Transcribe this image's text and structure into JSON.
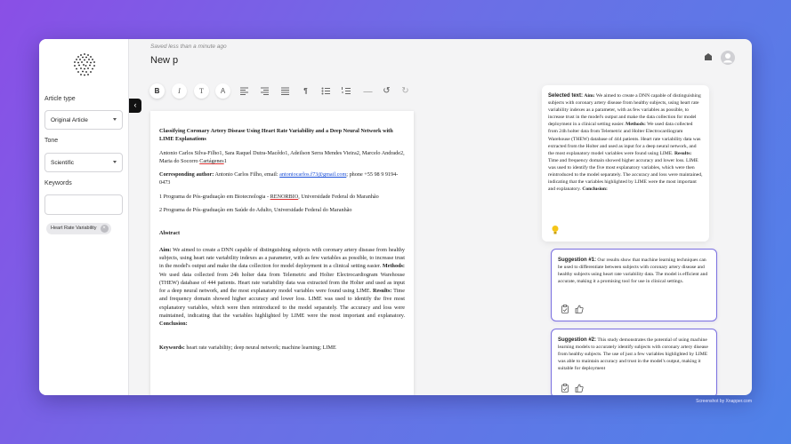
{
  "sidebar": {
    "article_type_label": "Article type",
    "article_type_value": "Original Article",
    "tone_label": "Tone",
    "tone_value": "Scientific",
    "keywords_label": "Keywords",
    "keyword_chip": "Heart Rate Variability",
    "chip_remove": "×"
  },
  "header": {
    "saved_status": "Saved less than a minute ago",
    "doc_title": "New p",
    "collapse_icon": "‹"
  },
  "toolbar": {
    "bold": "B",
    "italic": "I",
    "text": "T",
    "font": "A",
    "paragraph": "¶",
    "underscore": "___",
    "undo": "↺",
    "redo": "↻"
  },
  "document": {
    "title": "Classifying Coronary Artery Disease Using Heart Rate Variability and a Deep Neural Network with LIME Explanations",
    "authors_a": "Antonio Carlos Silva-Filho1, Sara Raquel Dutra-Macêdo1, Adeilson Serra Mendes Vieira2, Marcelo Andrade2, Maria do Socorro ",
    "authors_b": "Cartágenes",
    "authors_c": "1",
    "corr_label": "Corresponding author:",
    "corr_text_a": " Antonio Carlos Filho, email: ",
    "corr_email": "antoniocarlos.f73@gmail.com",
    "corr_text_b": "; phone +55 98 9 9194-0473",
    "aff1_a": "1 Programa de Pós-graduação em Biotecnologia - ",
    "aff1_b": "RENORBIO",
    "aff1_c": ", Universidade Federal do Maranhão",
    "aff2": "2 Programa de Pós-graduação em Saúde do Adulto, Universidade Federal do Maranhão",
    "abstract_heading": "Abstract",
    "aim_label": "Aim:",
    "aim_text": " We aimed to create a DNN capable of distinguishing subjects with coronary artery disease from healthy subjects, using heart rate variability indexes as a parameter, with as few variables as possible, to increase trust in the model's output and make the data collection for model deployment in a clinical setting easier. ",
    "methods_label": "Methods:",
    "methods_text": " We used data collected from 24h holter data from Telemetric and Holter Electrocardiogram Warehouse (THEW) database of 444 patients. Heart rate variability data was extracted from the Holter and used as input for a deep neural network, and the most explanatory model variables were found using LIME. ",
    "results_label": "Results:",
    "results_text": " Time and frequency domain showed higher accuracy and lower loss. LIME was used to identify the five most explanatory variables, which were then reintroduced to the model separately. The accuracy and loss were maintained, indicating that the variables highlighted by LIME were the most important and explanatory. ",
    "conclusion_label": "Conclusion:",
    "keywords_label": "Keywords:",
    "keywords_text": " heart rate variability; deep neural network; machine learning; LIME"
  },
  "assistant": {
    "selected_label": "Selected text:",
    "selected_aim_label": "Aim:",
    "selected_aim": " We aimed to create a DNN capable of distinguishing subjects with coronary artery disease from healthy subjects, using heart rate variability indexes as a parameter, with as few variables as possible, to increase trust in the model's output and make the data collection for model deployment in a clinical setting easier. ",
    "selected_methods_label": "Methods:",
    "selected_methods": " We used data collected from 24h holter data from Telemetric and Holter Electrocardiogram Warehouse (THEW) database of 444 patients. Heart rate variability data was extracted from the Holter and used as input for a deep neural network, and the most explanatory model variables were found using LIME. ",
    "selected_results_label": "Results:",
    "selected_results": " Time and frequency domain showed higher accuracy and lower loss. LIME was used to identify the five most explanatory variables, which were then reintroduced to the model separately. The accuracy and loss were maintained, indicating that the variables highlighted by LIME were the most important and explanatory. ",
    "selected_conclusion_label": "Conclusion:",
    "suggestions": [
      {
        "label": "Suggestion #1:",
        "text": " Our results show that machine learning techniques can be used to differentiate between subjects with coronary artery disease and healthy subjects using heart rate variability data. The model is efficient and accurate, making it a promising tool for use in clinical settings."
      },
      {
        "label": "Suggestion #2:",
        "text": " This study demonstrates the potential of using machine learning models to accurately identify subjects with coronary artery disease from healthy subjects. The use of just a few variables highlighted by LIME was able to maintain accuracy and trust in the model's output, making it suitable for deployment"
      }
    ]
  },
  "credit": "Screenshot by Xnapper.com",
  "colors": {
    "accent": "#7a6fe0",
    "link": "#1a4fd8"
  }
}
